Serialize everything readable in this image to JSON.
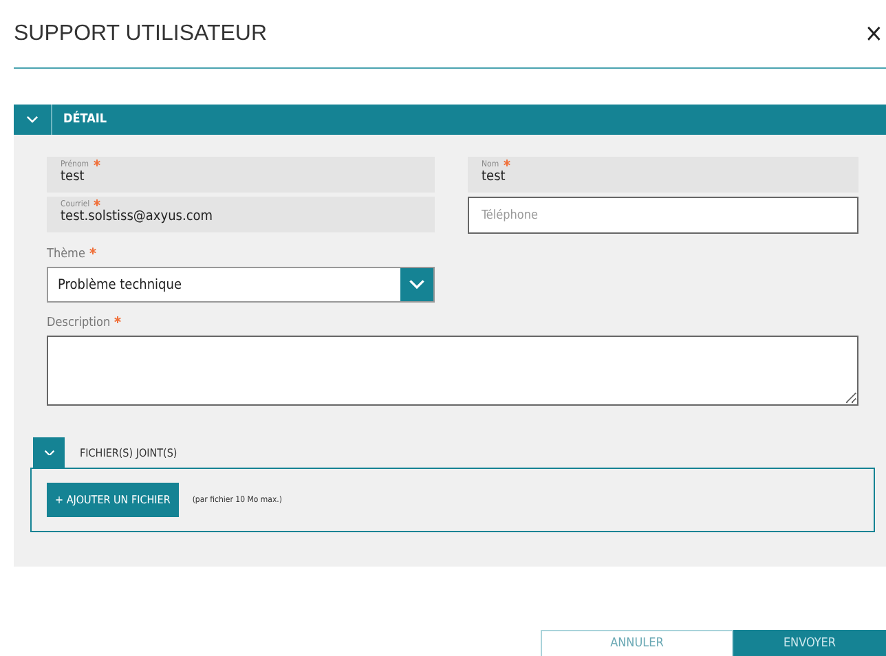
{
  "dialog": {
    "title": "SUPPORT UTILISATEUR",
    "close": "×"
  },
  "section": {
    "title": "DÉTAIL",
    "expanded": true
  },
  "fields": [
    {
      "kind": "readonly",
      "label": "Prénom",
      "required": true,
      "value": "test"
    },
    {
      "kind": "readonly",
      "label": "Nom",
      "required": true,
      "value": "test"
    },
    {
      "kind": "readonly",
      "label": "Courriel",
      "required": true,
      "value": "test.solstiss@axyus.com"
    },
    {
      "kind": "input",
      "placeholder": "Téléphone"
    }
  ],
  "theme": {
    "label": "Thème",
    "required": true,
    "value": "Problème technique"
  },
  "description": {
    "label": "Description",
    "required": true
  },
  "attachments": {
    "title": "FICHIER(S) JOINT(S)",
    "expanded": true,
    "button": "+ AJOUTER UN FICHIER",
    "hint": "(par fichier 10 Mo max.)"
  },
  "buttons": [
    {
      "label": "ANNULER",
      "kind": "secondary"
    },
    {
      "label": "ENVOYER",
      "kind": "primary"
    }
  ]
}
